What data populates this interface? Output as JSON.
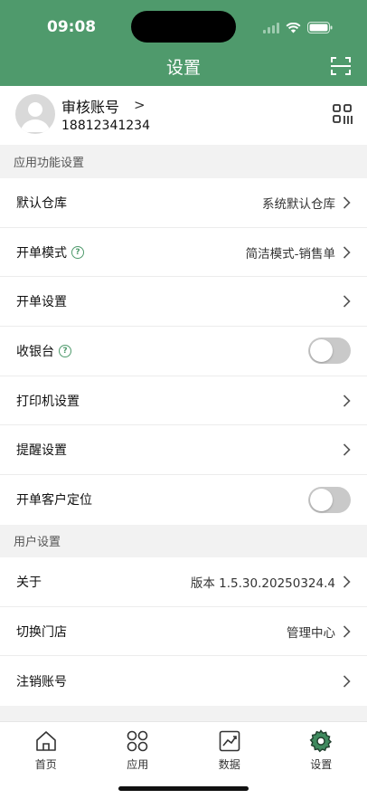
{
  "status": {
    "time": "09:08"
  },
  "nav": {
    "title": "设置",
    "scan_icon": "scan-icon"
  },
  "profile": {
    "name": "审核账号",
    "arrow": ">",
    "phone": "18812341234"
  },
  "colors": {
    "brand": "#4f9a6c",
    "toggle_off": "#c9c9c9"
  },
  "sections": {
    "app": {
      "title": "应用功能设置",
      "rows": [
        {
          "label": "默认仓库",
          "value": "系统默认仓库"
        },
        {
          "label": "开单模式",
          "value": "简洁模式-销售单"
        },
        {
          "label": "开单设置",
          "value": ""
        },
        {
          "label": "收银台",
          "toggle": false
        },
        {
          "label": "打印机设置",
          "value": ""
        },
        {
          "label": "提醒设置",
          "value": ""
        },
        {
          "label": "开单客户定位",
          "toggle": false
        }
      ]
    },
    "user": {
      "title": "用户设置",
      "rows": [
        {
          "label": "关于",
          "value": "版本 1.5.30.20250324.4"
        },
        {
          "label": "切换门店",
          "value": "管理中心"
        },
        {
          "label": "注销账号",
          "value": ""
        }
      ]
    }
  },
  "tabs": [
    {
      "label": "首页",
      "icon": "home-icon"
    },
    {
      "label": "应用",
      "icon": "apps-icon"
    },
    {
      "label": "数据",
      "icon": "chart-icon"
    },
    {
      "label": "设置",
      "icon": "settings-gear-icon",
      "active": true
    }
  ]
}
